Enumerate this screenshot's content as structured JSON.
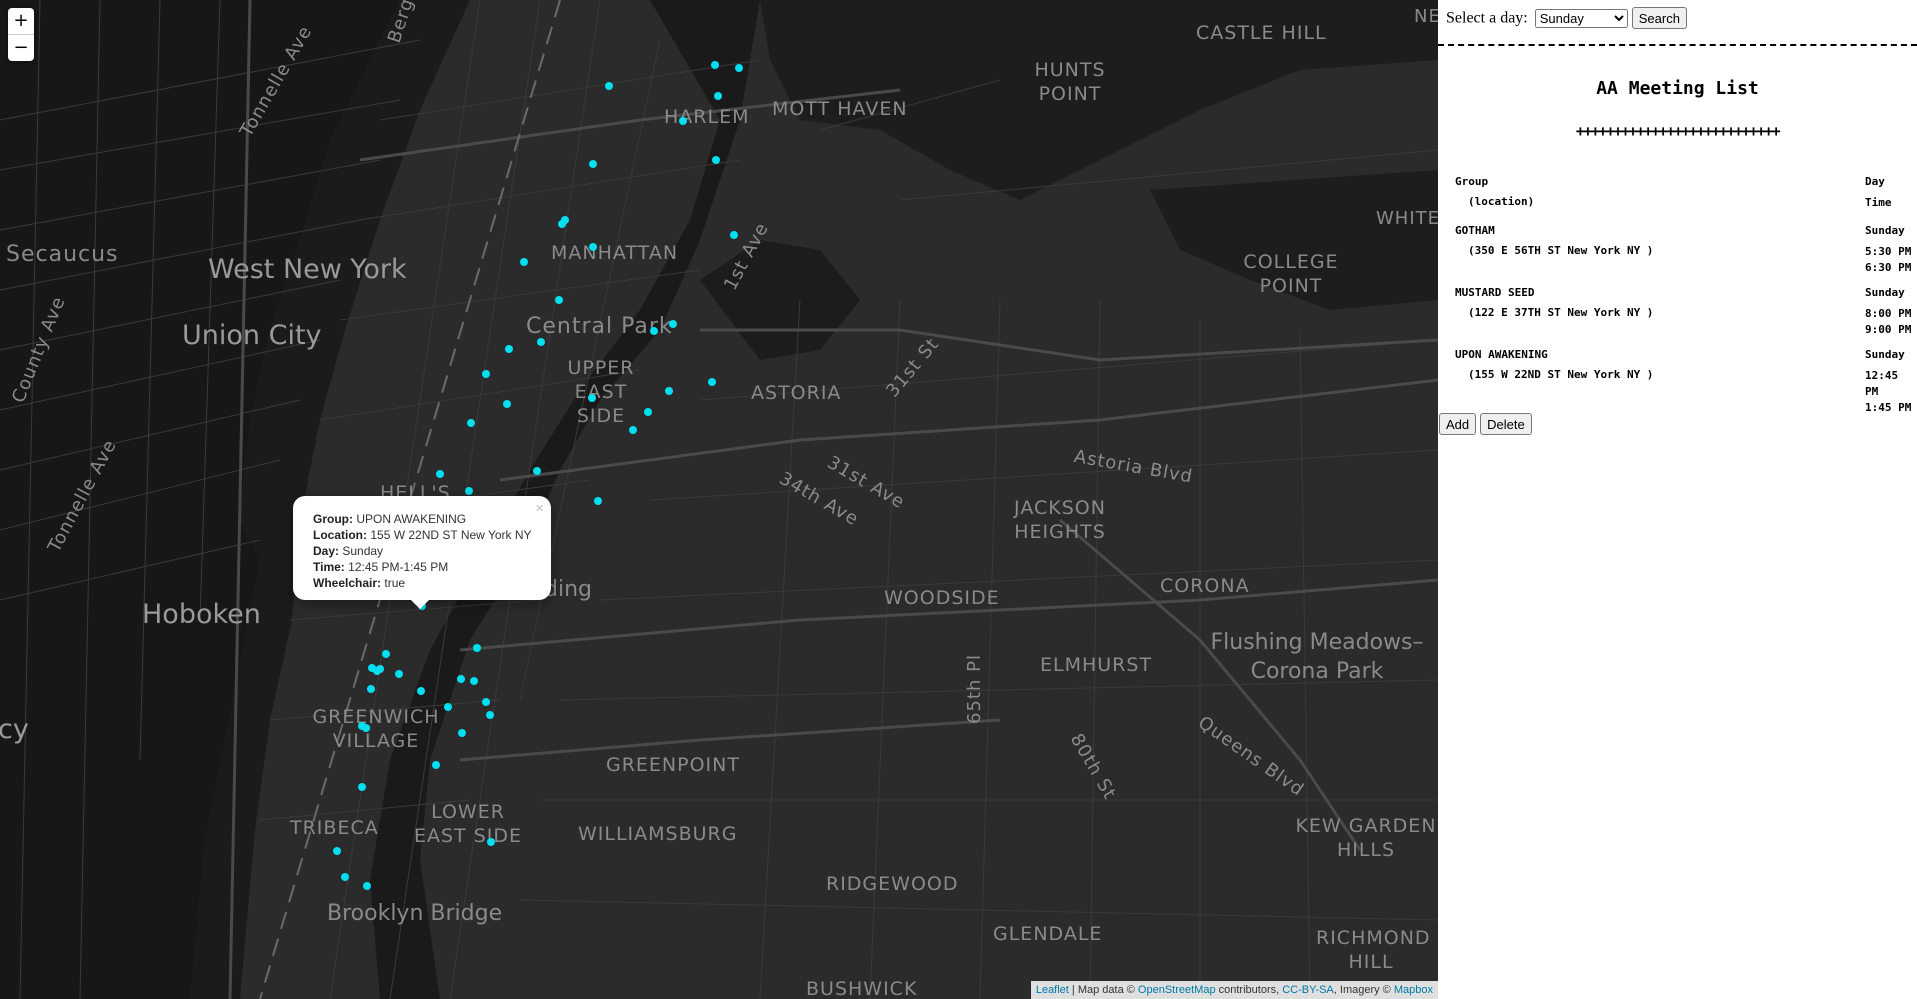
{
  "map": {
    "zoom_in": "+",
    "zoom_out": "−",
    "labels": {
      "secaucus": "Secaucus",
      "west_new_york": "West New York",
      "union_city": "Union City",
      "hoboken": "Hoboken",
      "harlem": "HARLEM",
      "mott_haven": "MOTT HAVEN",
      "castle_hill": "CASTLE HILL",
      "hunts_point": "HUNTS POINT",
      "manhattan": "MANHATTAN",
      "central_park": "Central Park",
      "upper_east_side": "UPPER EAST SIDE",
      "astoria": "ASTORIA",
      "college_point": "COLLEGE POINT",
      "jackson_heights": "JACKSON HEIGHTS",
      "woodside": "WOODSIDE",
      "corona": "CORONA",
      "elmhurst": "ELMHURST",
      "flushing": "Flushing Meadows–Corona Park",
      "greenwich_village": "GREENWICH VILLAGE",
      "greenpoint": "GREENPOINT",
      "tribeca": "TRIBECA",
      "lower_east_side": "LOWER EAST SIDE",
      "williamsburg": "WILLIAMSBURG",
      "ridgewood": "RIDGEWOOD",
      "glendale": "GLENDALE",
      "kew_gardens_hills": "KEW GARDEN HILLS",
      "richmond_hill": "RICHMOND HILL",
      "bushwick": "BUSHWICK",
      "brooklyn_bridge": "Brooklyn Bridge",
      "hells_kitchen": "HELL'S",
      "building": "ding",
      "tonnelle_ave_1": "Tonnelle Ave",
      "tonnelle_ave_2": "Tonnelle Ave",
      "county_ave": "County Ave",
      "first_ave": "1st Ave",
      "st_31_1": "31st St",
      "ave_31": "31st Ave",
      "ave_34": "34th Ave",
      "astoria_blvd": "Astoria Blvd",
      "pl_65": "65th Pl",
      "st_80": "80th St",
      "queens_blvd": "Queens Blvd",
      "berg": "Berg",
      "white": "WHITE",
      "ne": "NE",
      "cy": "cy"
    },
    "popup": {
      "close": "×",
      "group_label": "Group:",
      "group": "UPON AWAKENING",
      "location_label": "Location:",
      "location": "155 W 22ND ST New York NY",
      "day_label": "Day:",
      "day": "Sunday",
      "time_label": "Time:",
      "time": "12:45 PM-1:45 PM",
      "wheelchair_label": "Wheelchair:",
      "wheelchair": "true"
    },
    "attribution": {
      "leaflet": "Leaflet",
      "text1": " | Map data © ",
      "osm": "OpenStreetMap",
      "text2": " contributors, ",
      "cc": "CC-BY-SA",
      "text3": ", Imagery © ",
      "mapbox": "Mapbox"
    },
    "marker_color": "#00e0f0"
  },
  "panel": {
    "day_label": "Select a day:",
    "day_value": "Sunday",
    "search_button": "Search",
    "title": "AA Meeting List",
    "separator": "+++++++++++++++++++++++++++",
    "headers": {
      "group": "Group",
      "location": "(location)",
      "day": "Day",
      "time": "Time"
    },
    "meetings": [
      {
        "group": "GOTHAM",
        "location": "(350 E 56TH ST New York NY )",
        "day": "Sunday",
        "time1": "5:30 PM",
        "time2": "6:30 PM"
      },
      {
        "group": "MUSTARD SEED",
        "location": "(122 E 37TH ST New York NY )",
        "day": "Sunday",
        "time1": "8:00 PM",
        "time2": "9:00 PM"
      },
      {
        "group": "UPON AWAKENING",
        "location": "(155 W 22ND ST New York NY )",
        "day": "Sunday",
        "time1": "12:45 PM",
        "time2": "1:45 PM"
      }
    ],
    "add_button": "Add",
    "delete_button": "Delete"
  }
}
